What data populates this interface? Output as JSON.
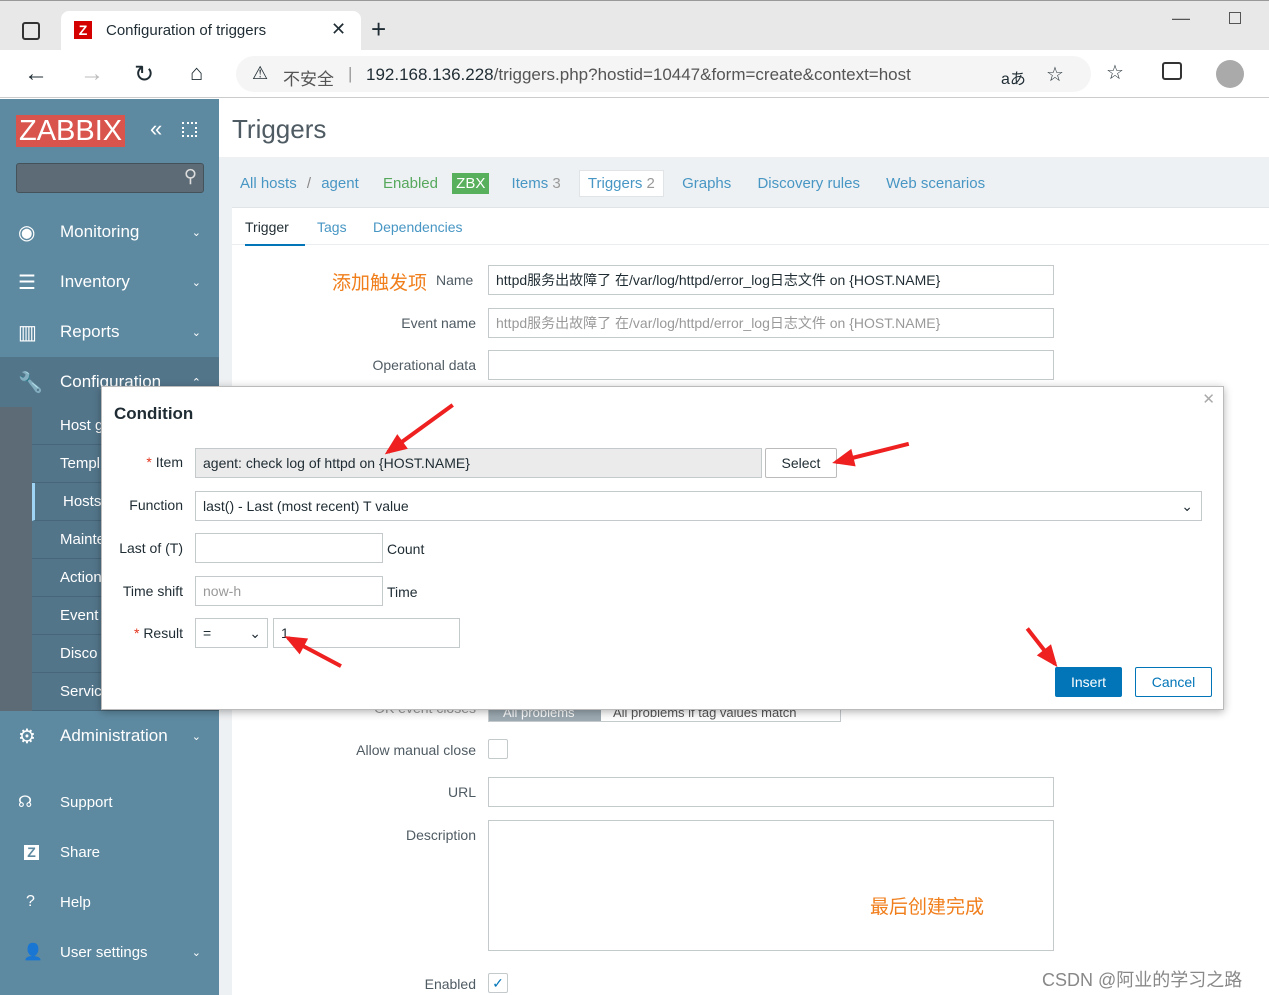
{
  "browser": {
    "tab_title": "Configuration of triggers",
    "insecure": "不安全",
    "url_host": "192.168.136.228",
    "url_path": "/triggers.php?hostid=10447&form=create&context=host",
    "read_aloud": "aあ"
  },
  "sidebar": {
    "logo": "ZABBIX",
    "menu": [
      {
        "label": "Monitoring",
        "icon": "eye-icon"
      },
      {
        "label": "Inventory",
        "icon": "list-icon"
      },
      {
        "label": "Reports",
        "icon": "chart-icon"
      },
      {
        "label": "Configuration",
        "icon": "wrench-icon"
      }
    ],
    "sub": [
      "Host g",
      "Templ",
      "Hosts",
      "Mainte",
      "Action",
      "Event",
      "Disco",
      "Servic"
    ],
    "bottom": [
      {
        "label": "Administration",
        "icon": "gear-icon"
      },
      {
        "label": "Support",
        "icon": "headset-icon"
      },
      {
        "label": "Share",
        "icon": "zabbix-share-icon"
      },
      {
        "label": "Help",
        "icon": "help-icon"
      },
      {
        "label": "User settings",
        "icon": "user-icon"
      }
    ]
  },
  "page": {
    "title": "Triggers",
    "breadcrumb": {
      "all_hosts": "All hosts",
      "sep": "/",
      "host": "agent",
      "status": "Enabled",
      "zbx": "ZBX",
      "items": "Items",
      "items_count": "3",
      "triggers": "Triggers",
      "triggers_count": "2",
      "graphs": "Graphs",
      "discovery": "Discovery rules",
      "web": "Web scenarios"
    },
    "tabs": [
      "Trigger",
      "Tags",
      "Dependencies"
    ],
    "annotation_name": "添加触发项",
    "form": {
      "name_label": "Name",
      "name_value": "httpd服务出故障了 在/var/log/httpd/error_log日志文件 on {HOST.NAME}",
      "event_label": "Event name",
      "event_placeholder": "httpd服务出故障了 在/var/log/httpd/error_log日志文件 on {HOST.NAME}",
      "opdata_label": "Operational data",
      "ok_close_label": "OK event closes",
      "ok_close_opts": [
        "All problems",
        "All problems if tag values match"
      ],
      "manual_close_label": "Allow manual close",
      "url_label": "URL",
      "desc_label": "Description",
      "enabled_label": "Enabled"
    },
    "annotation_done": "最后创建完成"
  },
  "modal": {
    "title": "Condition",
    "item_label": "Item",
    "item_value": "agent: check log of httpd on {HOST.NAME}",
    "select": "Select",
    "function_label": "Function",
    "function_value": "last() - Last (most recent) T value",
    "last_label": "Last of (T)",
    "last_value": "",
    "count": "Count",
    "shift_label": "Time shift",
    "shift_placeholder": "now-h",
    "time": "Time",
    "result_label": "Result",
    "result_op": "=",
    "result_value": "1",
    "insert": "Insert",
    "cancel": "Cancel"
  },
  "watermark": "CSDN @阿业的学习之路",
  "colors": {
    "sidebar": "#5e8aa1",
    "brand": "#d9544d",
    "link": "#4796c4",
    "primary": "#0275b8",
    "annotation": "#f07e1b"
  }
}
